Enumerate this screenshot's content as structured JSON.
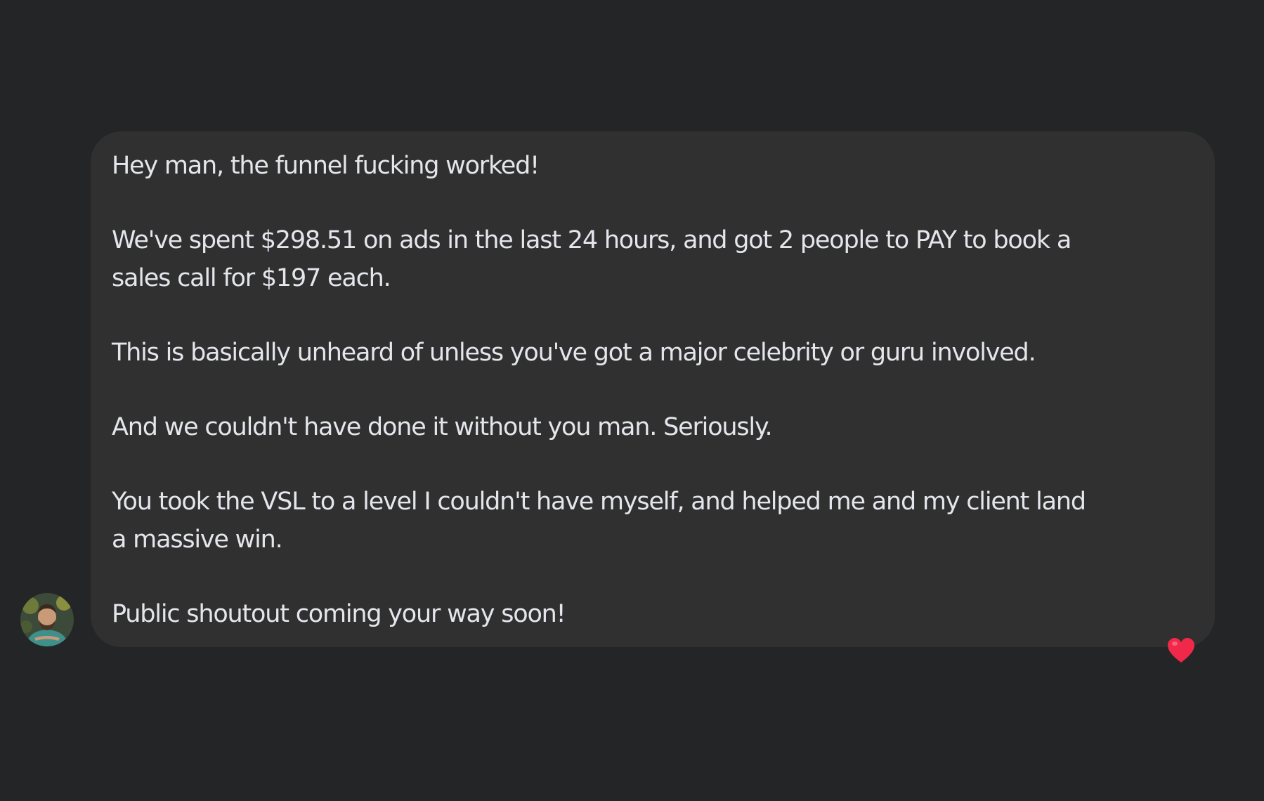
{
  "message": {
    "lines": [
      "Hey man, the funnel fucking worked!",
      "We've spent $298.51 on ads in the last 24 hours, and got 2 people to PAY to book a",
      "sales call for $197 each.",
      "This is basically unheard of unless you've got a major celebrity or guru involved.",
      "And we couldn't have done it without you man. Seriously.",
      "You took the VSL to a level I couldn't have myself, and helped me and my client land",
      "a massive win.",
      "Public shoutout coming your way soon!"
    ]
  },
  "reaction": {
    "icon": "heart-icon",
    "color": "#f0284a"
  },
  "colors": {
    "background": "#242526",
    "bubble": "#303030",
    "text": "#e4e6eb"
  }
}
